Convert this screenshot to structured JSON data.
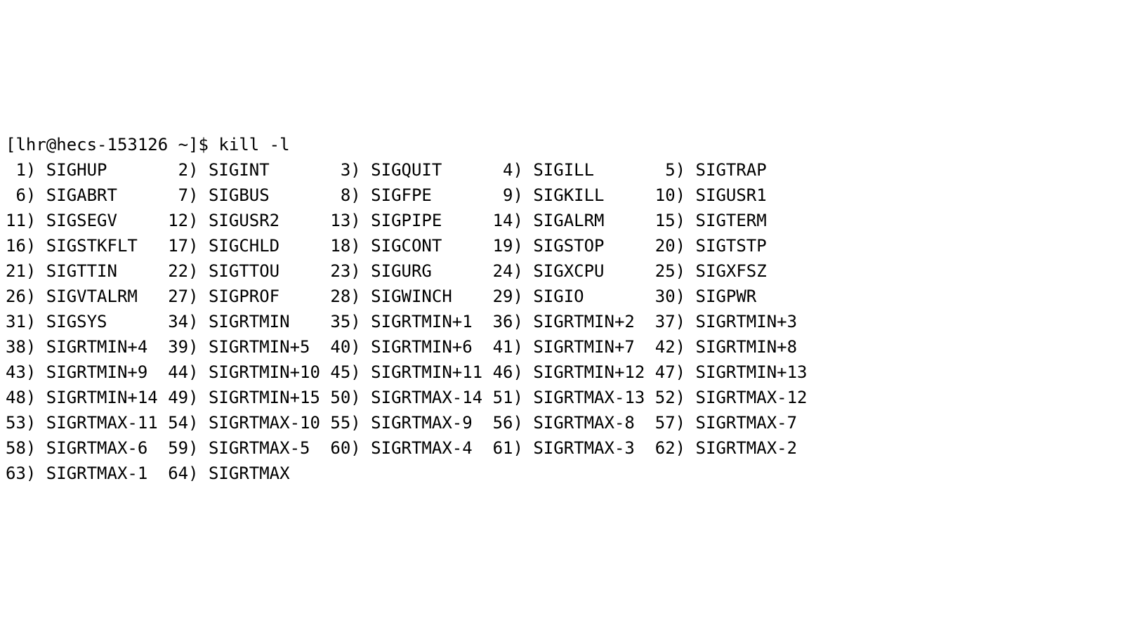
{
  "prompt": {
    "user": "lhr",
    "host": "hecs-153126",
    "path": "~",
    "symbol": "$",
    "command": "kill -l"
  },
  "signals": [
    {
      "num": 1,
      "name": "SIGHUP"
    },
    {
      "num": 2,
      "name": "SIGINT"
    },
    {
      "num": 3,
      "name": "SIGQUIT"
    },
    {
      "num": 4,
      "name": "SIGILL"
    },
    {
      "num": 5,
      "name": "SIGTRAP"
    },
    {
      "num": 6,
      "name": "SIGABRT"
    },
    {
      "num": 7,
      "name": "SIGBUS"
    },
    {
      "num": 8,
      "name": "SIGFPE"
    },
    {
      "num": 9,
      "name": "SIGKILL"
    },
    {
      "num": 10,
      "name": "SIGUSR1"
    },
    {
      "num": 11,
      "name": "SIGSEGV"
    },
    {
      "num": 12,
      "name": "SIGUSR2"
    },
    {
      "num": 13,
      "name": "SIGPIPE"
    },
    {
      "num": 14,
      "name": "SIGALRM"
    },
    {
      "num": 15,
      "name": "SIGTERM"
    },
    {
      "num": 16,
      "name": "SIGSTKFLT"
    },
    {
      "num": 17,
      "name": "SIGCHLD"
    },
    {
      "num": 18,
      "name": "SIGCONT"
    },
    {
      "num": 19,
      "name": "SIGSTOP"
    },
    {
      "num": 20,
      "name": "SIGTSTP"
    },
    {
      "num": 21,
      "name": "SIGTTIN"
    },
    {
      "num": 22,
      "name": "SIGTTOU"
    },
    {
      "num": 23,
      "name": "SIGURG"
    },
    {
      "num": 24,
      "name": "SIGXCPU"
    },
    {
      "num": 25,
      "name": "SIGXFSZ"
    },
    {
      "num": 26,
      "name": "SIGVTALRM"
    },
    {
      "num": 27,
      "name": "SIGPROF"
    },
    {
      "num": 28,
      "name": "SIGWINCH"
    },
    {
      "num": 29,
      "name": "SIGIO"
    },
    {
      "num": 30,
      "name": "SIGPWR"
    },
    {
      "num": 31,
      "name": "SIGSYS"
    },
    {
      "num": 34,
      "name": "SIGRTMIN"
    },
    {
      "num": 35,
      "name": "SIGRTMIN+1"
    },
    {
      "num": 36,
      "name": "SIGRTMIN+2"
    },
    {
      "num": 37,
      "name": "SIGRTMIN+3"
    },
    {
      "num": 38,
      "name": "SIGRTMIN+4"
    },
    {
      "num": 39,
      "name": "SIGRTMIN+5"
    },
    {
      "num": 40,
      "name": "SIGRTMIN+6"
    },
    {
      "num": 41,
      "name": "SIGRTMIN+7"
    },
    {
      "num": 42,
      "name": "SIGRTMIN+8"
    },
    {
      "num": 43,
      "name": "SIGRTMIN+9"
    },
    {
      "num": 44,
      "name": "SIGRTMIN+10"
    },
    {
      "num": 45,
      "name": "SIGRTMIN+11"
    },
    {
      "num": 46,
      "name": "SIGRTMIN+12"
    },
    {
      "num": 47,
      "name": "SIGRTMIN+13"
    },
    {
      "num": 48,
      "name": "SIGRTMIN+14"
    },
    {
      "num": 49,
      "name": "SIGRTMIN+15"
    },
    {
      "num": 50,
      "name": "SIGRTMAX-14"
    },
    {
      "num": 51,
      "name": "SIGRTMAX-13"
    },
    {
      "num": 52,
      "name": "SIGRTMAX-12"
    },
    {
      "num": 53,
      "name": "SIGRTMAX-11"
    },
    {
      "num": 54,
      "name": "SIGRTMAX-10"
    },
    {
      "num": 55,
      "name": "SIGRTMAX-9"
    },
    {
      "num": 56,
      "name": "SIGRTMAX-8"
    },
    {
      "num": 57,
      "name": "SIGRTMAX-7"
    },
    {
      "num": 58,
      "name": "SIGRTMAX-6"
    },
    {
      "num": 59,
      "name": "SIGRTMAX-5"
    },
    {
      "num": 60,
      "name": "SIGRTMAX-4"
    },
    {
      "num": 61,
      "name": "SIGRTMAX-3"
    },
    {
      "num": 62,
      "name": "SIGRTMAX-2"
    },
    {
      "num": 63,
      "name": "SIGRTMAX-1"
    },
    {
      "num": 64,
      "name": "SIGRTMAX"
    }
  ],
  "layout": {
    "columns": 5,
    "num_width": 2,
    "name_width": 11
  }
}
